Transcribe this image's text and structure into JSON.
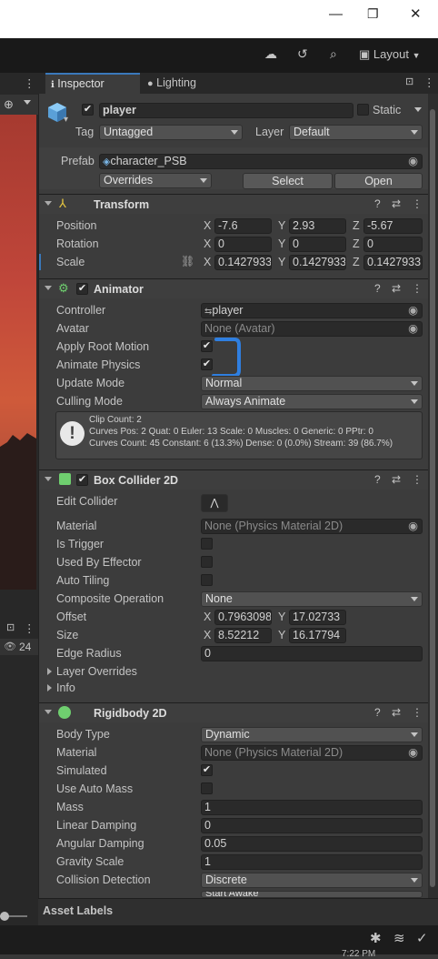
{
  "window": {
    "minimize": "—",
    "restore": "❐",
    "close": "✕"
  },
  "toolbar": {
    "layout_label": "Layout"
  },
  "tabs": [
    {
      "label": "Inspector"
    },
    {
      "label": "Lighting"
    }
  ],
  "left_strip": {
    "count": "24"
  },
  "object": {
    "name": "player",
    "static_label": "Static",
    "tag_label": "Tag",
    "tag_value": "Untagged",
    "layer_label": "Layer",
    "layer_value": "Default",
    "prefab_label": "Prefab",
    "prefab_value": "character_PSB",
    "overrides_label": "Overrides",
    "select_label": "Select",
    "open_label": "Open"
  },
  "transform": {
    "title": "Transform",
    "rows": [
      {
        "label": "Position",
        "x": "-7.6",
        "y": "2.93",
        "z": "-5.67"
      },
      {
        "label": "Rotation",
        "x": "0",
        "y": "0",
        "z": "0"
      },
      {
        "label": "Scale",
        "x": "0.1427933",
        "y": "0.1427933",
        "z": "0.1427933"
      }
    ]
  },
  "animator": {
    "title": "Animator",
    "controller_label": "Controller",
    "controller_value": "player",
    "avatar_label": "Avatar",
    "avatar_value": "None (Avatar)",
    "apply_root_motion_label": "Apply Root Motion",
    "apply_root_motion": true,
    "animate_physics_label": "Animate Physics",
    "animate_physics": true,
    "update_mode_label": "Update Mode",
    "update_mode": "Normal",
    "culling_mode_label": "Culling Mode",
    "culling_mode": "Always Animate",
    "info": [
      "Clip Count: 2",
      "Curves Pos: 2 Quat: 0 Euler: 13 Scale: 0 Muscles: 0 Generic: 0 PPtr: 0",
      "Curves Count: 45 Constant: 6 (13.3%) Dense: 0 (0.0%) Stream: 39 (86.7%)"
    ]
  },
  "box_collider": {
    "title": "Box Collider 2D",
    "edit_collider_label": "Edit Collider",
    "material_label": "Material",
    "material_value": "None (Physics Material 2D)",
    "is_trigger_label": "Is Trigger",
    "used_by_effector_label": "Used By Effector",
    "auto_tiling_label": "Auto Tiling",
    "composite_label": "Composite Operation",
    "composite_value": "None",
    "offset_label": "Offset",
    "offset_x": "0.7963098",
    "offset_y": "17.02733",
    "size_label": "Size",
    "size_x": "8.52212",
    "size_y": "16.17794",
    "edge_radius_label": "Edge Radius",
    "edge_radius": "0",
    "layer_overrides_label": "Layer Overrides",
    "info_label": "Info"
  },
  "rigidbody": {
    "title": "Rigidbody 2D",
    "body_type_label": "Body Type",
    "body_type": "Dynamic",
    "material_label": "Material",
    "material_value": "None (Physics Material 2D)",
    "simulated_label": "Simulated",
    "simulated": true,
    "use_auto_mass_label": "Use Auto Mass",
    "mass_label": "Mass",
    "mass": "1",
    "linear_damping_label": "Linear Damping",
    "linear_damping": "0",
    "angular_damping_label": "Angular Damping",
    "angular_damping": "0.05",
    "gravity_scale_label": "Gravity Scale",
    "gravity_scale": "1",
    "collision_detection_label": "Collision Detection",
    "collision_detection": "Discrete",
    "sleeping_mode_value": "Start Awake"
  },
  "axis": {
    "x": "X",
    "y": "Y",
    "z": "Z"
  },
  "footer": {
    "asset_labels": "Asset Labels"
  },
  "taskbar": {
    "time": "7:22 PM"
  },
  "colors": {
    "accent": "#3a79bb",
    "panel": "#3c3c3c",
    "annotation": "#2f7fe0"
  }
}
